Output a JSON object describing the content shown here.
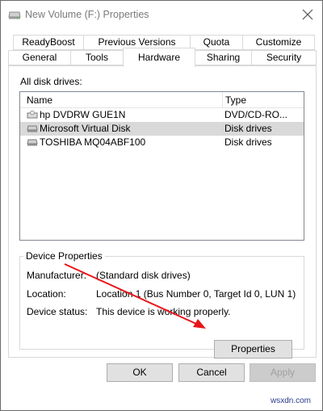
{
  "window": {
    "title": "New Volume (F:) Properties"
  },
  "tabs": {
    "row1": [
      "ReadyBoost",
      "Previous Versions",
      "Quota",
      "Customize"
    ],
    "row2": [
      "General",
      "Tools",
      "Hardware",
      "Sharing",
      "Security"
    ],
    "active": "Hardware"
  },
  "hardware": {
    "list_label": "All disk drives:",
    "columns": {
      "name": "Name",
      "type": "Type"
    },
    "drives": [
      {
        "name": "hp DVDRW GUE1N",
        "type": "DVD/CD-RO...",
        "icon": "dvd-drive-icon"
      },
      {
        "name": "Microsoft Virtual Disk",
        "type": "Disk drives",
        "icon": "disk-drive-icon",
        "selected": true
      },
      {
        "name": "TOSHIBA MQ04ABF100",
        "type": "Disk drives",
        "icon": "disk-drive-icon"
      }
    ]
  },
  "device_properties": {
    "title": "Device Properties",
    "manufacturer_label": "Manufacturer:",
    "manufacturer_value": "(Standard disk drives)",
    "location_label": "Location:",
    "location_value": "Location 1 (Bus Number 0, Target Id 0, LUN 1)",
    "status_label": "Device status:",
    "status_value": "This device is working properly.",
    "properties_button": "Properties"
  },
  "footer": {
    "ok": "OK",
    "cancel": "Cancel",
    "apply": "Apply"
  },
  "annotation": {
    "arrow_color": "#e8151b"
  },
  "watermark": "wsxdn.com"
}
